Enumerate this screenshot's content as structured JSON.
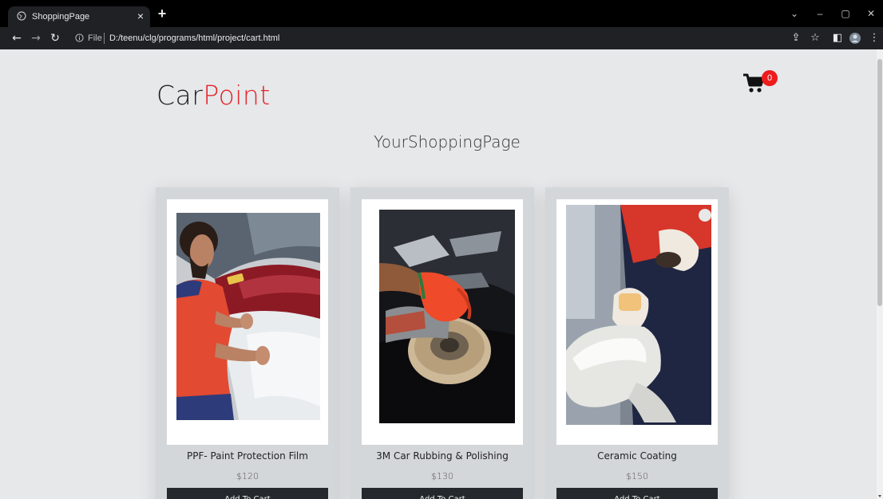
{
  "browser": {
    "tab_title": "ShoppingPage",
    "tab_close": "×",
    "new_tab": "+",
    "file_label": "File",
    "url": "D:/teenu/clg/programs/html/project/cart.html"
  },
  "page": {
    "logo_main": "Car",
    "logo_accent": "Point",
    "cart_count": "0",
    "heading": "YourShoppingPage"
  },
  "products": [
    {
      "name": "PPF- Paint Protection Film",
      "price": "$120",
      "button": "Add To Cart"
    },
    {
      "name": "3M Car Rubbing & Polishing",
      "price": "$130",
      "button": "Add To Cart"
    },
    {
      "name": "Ceramic Coating",
      "price": "$150",
      "button": "Add To Cart"
    }
  ],
  "colors": {
    "accent": "#e3242b",
    "badge": "#ee1c1c",
    "button": "#25282c",
    "background": "#e6e8ea"
  }
}
